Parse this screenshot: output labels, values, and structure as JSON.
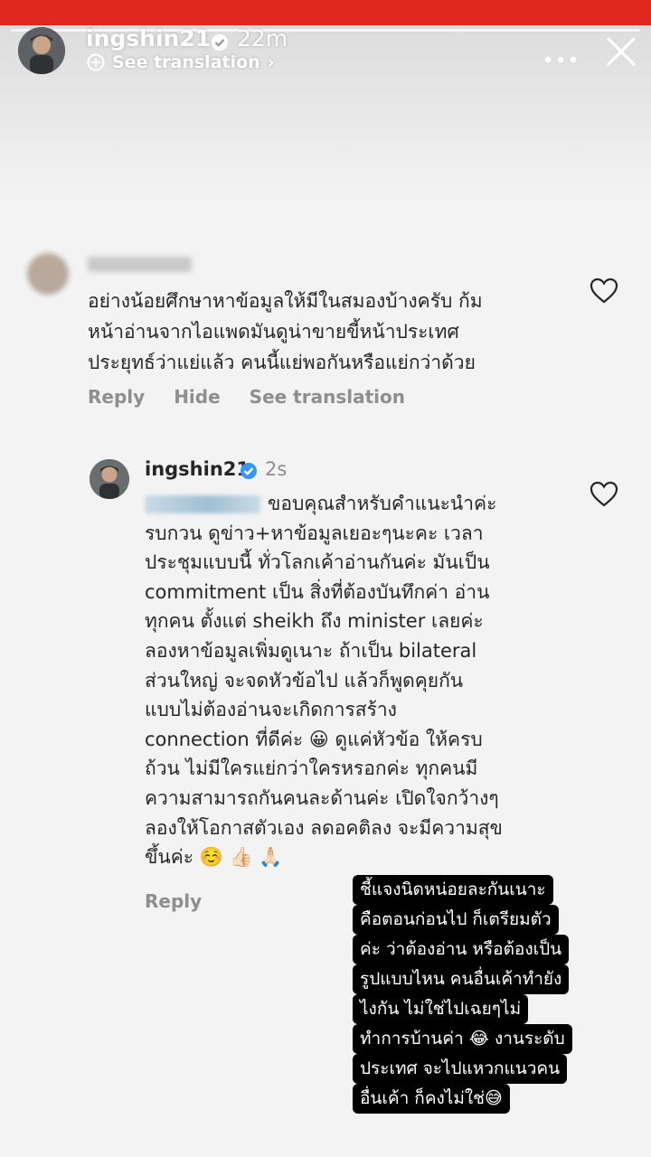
{
  "story": {
    "username": "ingshin21",
    "time": "22m",
    "see_translation": "See translation",
    "more_icon": "more-icon",
    "close_icon": "close-icon"
  },
  "comment": {
    "lines": [
      "อย่างน้อยศึกษาหาข้อมูลให้มีในสมองบ้างครับ ก้ม",
      "หน้าอ่านจากไอแพดมันดูน่าขายขี้หน้าประเทศ",
      "ประยุทธ์ว่าแย่แล้ว คนนี้แย่พอกันหรือแย่กว่าด้วย"
    ],
    "actions": [
      "Reply",
      "Hide",
      "See translation"
    ]
  },
  "reply": {
    "username": "ingshin21",
    "time": "2s",
    "lines": [
      "ขอบคุณสำหรับคำแนะนำค่ะ",
      "รบกวน ดูข่าว+หาข้อมูลเยอะๆนะคะ เวลา",
      "ประชุมแบบนี้ ทั่วโลกเค้าอ่านกันค่ะ มันเป็น",
      "commitment เป็น สิ่งที่ต้องบันทึกค่า อ่าน",
      "ทุกคน ตั้งแต่ sheikh ถึง minister เลยค่ะ",
      "ลองหาข้อมูลเพิ่มดูเนาะ ถ้าเป็น bilateral",
      "ส่วนใหญ่ จะจดหัวข้อไป แล้วก็พูดคุยกัน",
      "แบบไม่ต้องอ่านจะเกิดการสร้าง",
      "connection ที่ดีค่ะ 😀 ดูแค่หัวข้อ ให้ครบ",
      "ถ้วน ไม่มีใครแย่กว่าใครหรอกค่ะ ทุกคนมี",
      "ความสามารถกันคนละด้านค่ะ เปิดใจกว้างๆ",
      "ลองให้โอกาสตัวเอง ลดอคติลง จะมีความสุข",
      "ขึ้นค่ะ ☺️ 👍🏻 🙏🏻"
    ],
    "action": "Reply"
  },
  "caption_lines": [
    "ชี้แจงนิดหน่อยละกันเนาะ",
    "คือตอนก่อนไป ก็เตรียมตัว",
    "ค่ะ ว่าต้องอ่าน หรือต้องเป็น",
    "รูปแบบไหน คนอื่นเค้าทำยัง",
    "ไงกัน ไม่ใช่ไปเฉยๆไม่",
    "ทำการบ้านค่า 😂 งานระดับ",
    "ประเทศ จะไปแหวกแนวคน",
    "อื่นเค้า ก็คงไม่ใช่😅"
  ],
  "colors": {
    "top_bar": "#e0291e",
    "verified": "#3897f0",
    "secondary_text": "#8e8e8e",
    "caption_bg": "#000000"
  }
}
